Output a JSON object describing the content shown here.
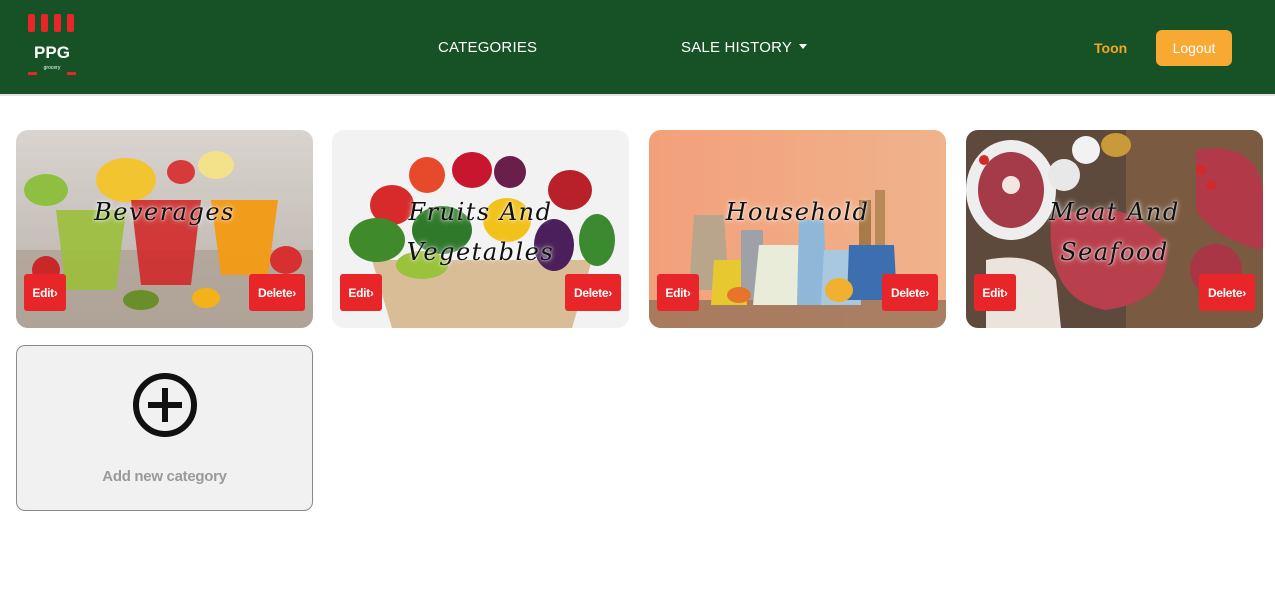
{
  "navbar": {
    "logo": {
      "text": "PPG",
      "icon": "ppg-grocery-logo"
    },
    "links": [
      {
        "label": "CATEGORIES"
      },
      {
        "label": "SALE HISTORY",
        "dropdown": true
      }
    ],
    "user_name": "Toon",
    "logout_label": "Logout"
  },
  "categories": [
    {
      "title_lines": [
        "Beverages"
      ],
      "edit_label": "Edit›",
      "delete_label": "Delete›",
      "image": "fruit-juices-photo"
    },
    {
      "title_lines": [
        "Fruits And",
        "Vegetables"
      ],
      "edit_label": "Edit›",
      "delete_label": "Delete›",
      "image": "fruits-vegetables-bag-photo"
    },
    {
      "title_lines": [
        "Household"
      ],
      "edit_label": "Edit›",
      "delete_label": "Delete›",
      "image": "kitchenware-photo"
    },
    {
      "title_lines": [
        "Meat And",
        "Seafood"
      ],
      "edit_label": "Edit›",
      "delete_label": "Delete›",
      "image": "raw-meat-photo"
    }
  ],
  "add_category": {
    "label": "Add new category",
    "icon": "plus-circle-icon"
  },
  "colors": {
    "navbar": "#165226",
    "accent": "#f7a933",
    "danger": "#e8262a",
    "user": "#f5a623"
  }
}
